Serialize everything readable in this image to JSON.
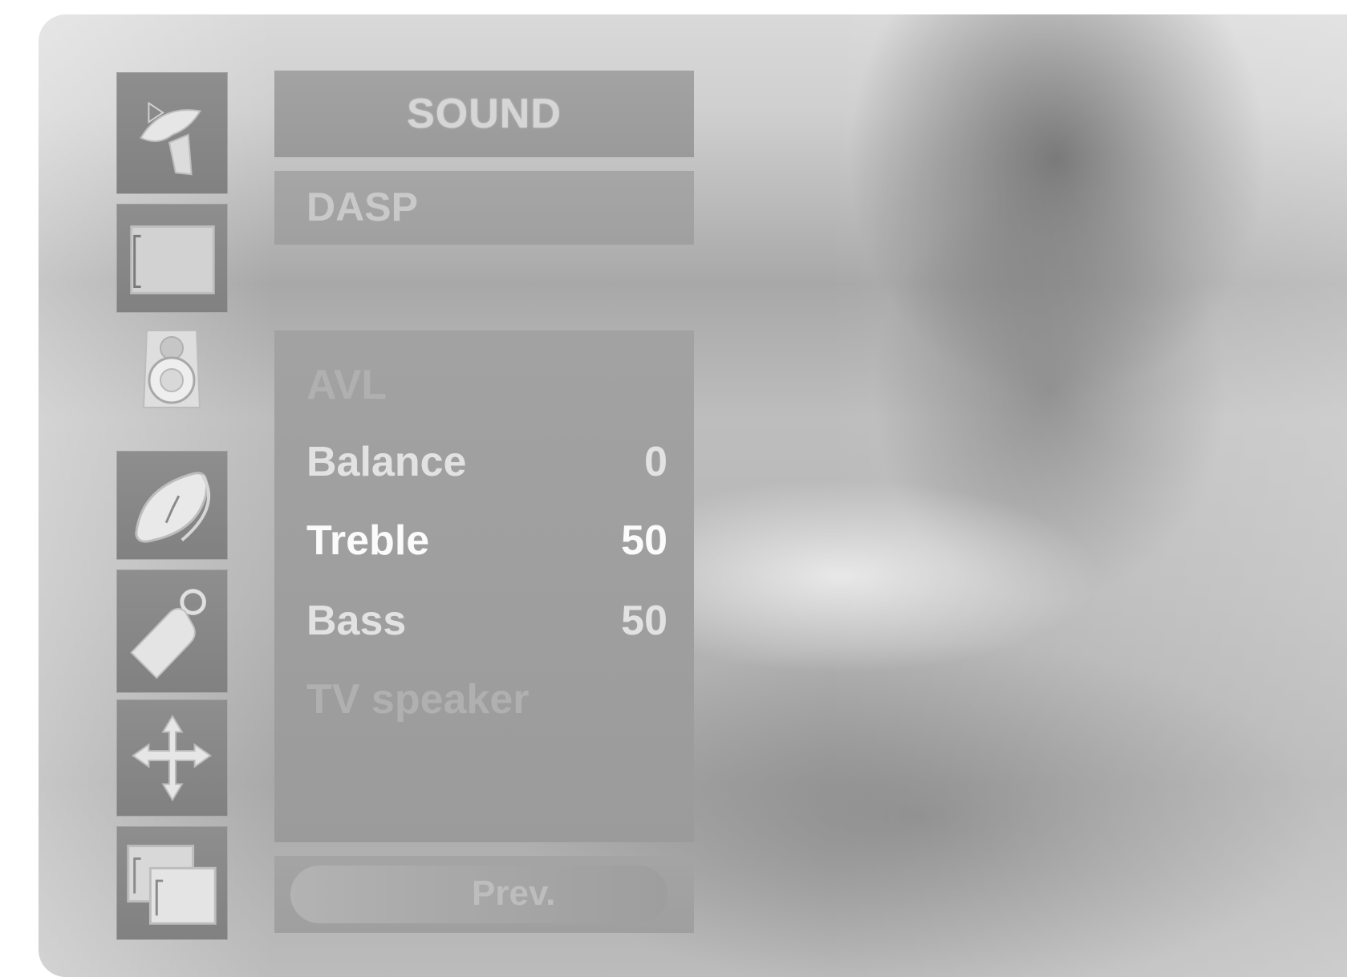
{
  "menu": {
    "title": "SOUND",
    "dasp_label": "DASP",
    "items": [
      {
        "label": "AVL",
        "value": ""
      },
      {
        "label": "Balance",
        "value": "0"
      },
      {
        "label": "Treble",
        "value": "50"
      },
      {
        "label": "Bass",
        "value": "50"
      },
      {
        "label": "TV speaker",
        "value": ""
      }
    ],
    "prev_label": "Prev."
  },
  "sidebar": {
    "icons": [
      {
        "name": "station-antenna-icon"
      },
      {
        "name": "picture-screen-icon"
      },
      {
        "name": "sound-speaker-icon",
        "selected": true
      },
      {
        "name": "time-clock-icon"
      },
      {
        "name": "special-key-icon"
      },
      {
        "name": "screen-arrows-icon"
      },
      {
        "name": "pip-windows-icon"
      }
    ]
  },
  "colors": {
    "panel": "#a0a0a0",
    "tile": "#8a8a8a",
    "highlight_text": "#fbfbfb"
  }
}
